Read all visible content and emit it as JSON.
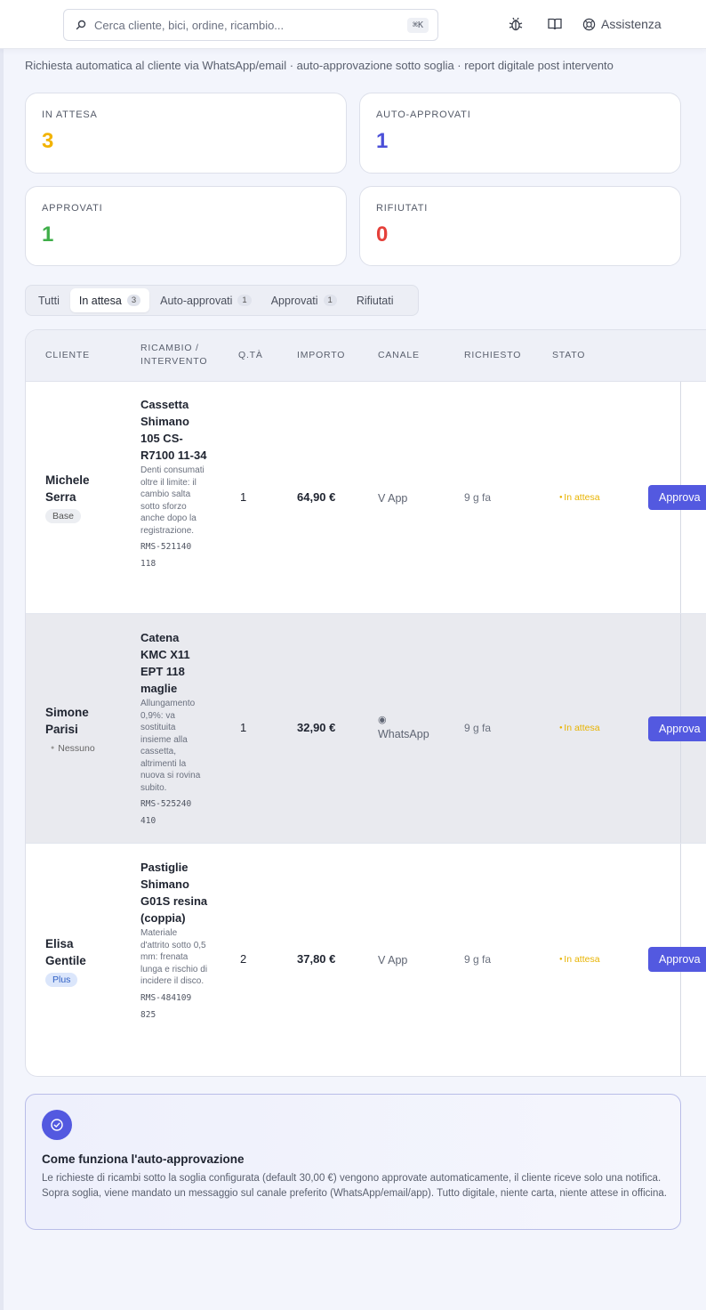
{
  "search": {
    "placeholder": "Cerca cliente, bici, ordine, ricambio...",
    "shortcut": "⌘K"
  },
  "header": {
    "help_label": "Assistenza",
    "icons": [
      "bug-icon",
      "book-icon",
      "lifebuoy-icon"
    ]
  },
  "page": {
    "subtitle": "Richiesta automatica al cliente via WhatsApp/email · auto-approvazione sotto soglia · report digitale post intervento"
  },
  "stats": [
    {
      "label": "IN ATTESA",
      "value": "3",
      "color": "#f2b300"
    },
    {
      "label": "AUTO-APPROVATI",
      "value": "1",
      "color": "#4b4fd8"
    },
    {
      "label": "APPROVATI",
      "value": "1",
      "color": "#3fae49"
    },
    {
      "label": "RIFIUTATI",
      "value": "0",
      "color": "#e5403a"
    }
  ],
  "tabs": [
    {
      "label": "Tutti",
      "count": ""
    },
    {
      "label": "In attesa",
      "count": "3"
    },
    {
      "label": "Auto-approvati",
      "count": "1"
    },
    {
      "label": "Approvati",
      "count": "1"
    },
    {
      "label": "Rifiutati",
      "count": ""
    }
  ],
  "table": {
    "headers": {
      "cliente": "CLIENTE",
      "ricambio_1": "RICAMBIO /",
      "ricambio_2": "INTERVENTO",
      "qta": "Q.TÀ",
      "importo": "IMPORTO",
      "canale": "CANALE",
      "richiesto": "RICHIESTO",
      "stato": "STATO"
    },
    "rows": [
      {
        "customer": "Michele Serra",
        "tier": "Base",
        "part": "Cassetta Shimano 105 CS-R7100 11-34",
        "desc": "Denti consumati oltre il limite: il cambio salta sotto sforzo anche dopo la registrazione.",
        "code": "RMS-521140118",
        "qty": "1",
        "amount": "64,90 €",
        "channel": "V App",
        "requested": "9 g fa",
        "status": "In attesa",
        "action": "Approva"
      },
      {
        "customer": "Simone Parisi",
        "tier": "Nessuno",
        "part": "Catena KMC X11 EPT 118 maglie",
        "desc": "Allungamento 0,9%: va sostituita insieme alla cassetta, altrimenti la nuova si rovina subito.",
        "code": "RMS-525240410",
        "qty": "1",
        "amount": "32,90 €",
        "channel_icon": "◉",
        "channel": "WhatsApp",
        "requested": "9 g fa",
        "status": "In attesa",
        "action": "Approva"
      },
      {
        "customer": "Elisa Gentile",
        "tier": "Plus",
        "part": "Pastiglie Shimano G01S resina (coppia)",
        "desc": "Materiale d'attrito sotto 0,5 mm: frenata lunga e rischio di incidere il disco.",
        "code": "RMS-484109825",
        "qty": "2",
        "amount": "37,80 €",
        "channel": "V App",
        "requested": "9 g fa",
        "status": "In attesa",
        "action": "Approva"
      }
    ]
  },
  "info": {
    "title": "Come funziona l'auto-approvazione",
    "text": "Le richieste di ricambi sotto la soglia configurata (default 30,00 €) vengono approvate automaticamente, il cliente riceve solo una notifica. Sopra soglia, viene mandato un messaggio sul canale preferito (WhatsApp/email/app). Tutto digitale, niente carta, niente attese in officina."
  }
}
